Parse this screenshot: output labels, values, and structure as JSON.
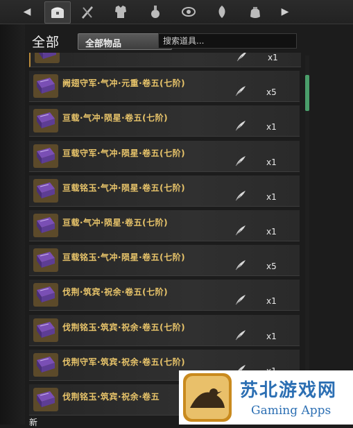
{
  "tabs": [
    {
      "icon": "chest-icon",
      "active": true
    },
    {
      "icon": "weapon-icon",
      "active": false
    },
    {
      "icon": "armor-icon",
      "active": false
    },
    {
      "icon": "potion-icon",
      "active": false
    },
    {
      "icon": "accessory-icon",
      "active": false
    },
    {
      "icon": "herb-icon",
      "active": false
    },
    {
      "icon": "pouch-icon",
      "active": false
    }
  ],
  "filter": {
    "category_title": "全部",
    "dropdown_value": "全部物品",
    "search_placeholder": "搜索道具..."
  },
  "items": [
    {
      "name": "",
      "qty": "x1"
    },
    {
      "name": "阙翅守军·气冲·元重·卷五(七阶)",
      "qty": "x5"
    },
    {
      "name": "亘载·气冲·陨星·卷五(七阶)",
      "qty": "x1"
    },
    {
      "name": "亘载守军·气冲·陨星·卷五(七阶)",
      "qty": "x1"
    },
    {
      "name": "亘载铭玉·气冲·陨星·卷五(七阶)",
      "qty": "x1"
    },
    {
      "name": "亘载·气冲·陨星·卷五(七阶)",
      "qty": "x1"
    },
    {
      "name": "亘载铭玉·气冲·陨星·卷五(七阶)",
      "qty": "x5"
    },
    {
      "name": "伐荆·筑宾·祝余·卷五(七阶)",
      "qty": "x1"
    },
    {
      "name": "伐荆铭玉·筑宾·祝余·卷五(七阶)",
      "qty": "x1"
    },
    {
      "name": "伐荆守军·筑宾·祝余·卷五(七阶)",
      "qty": "x1"
    },
    {
      "name": "伐荆铭玉·筑宾·祝余·卷五",
      "qty": ""
    }
  ],
  "bottom_label": "新",
  "watermark": {
    "title": "苏北游戏网",
    "subtitle": "Gaming Apps"
  },
  "colors": {
    "item_name": "#e8c46a",
    "scroll_thumb": "#4a9e6a",
    "book_purple": "#7a4fb5"
  }
}
